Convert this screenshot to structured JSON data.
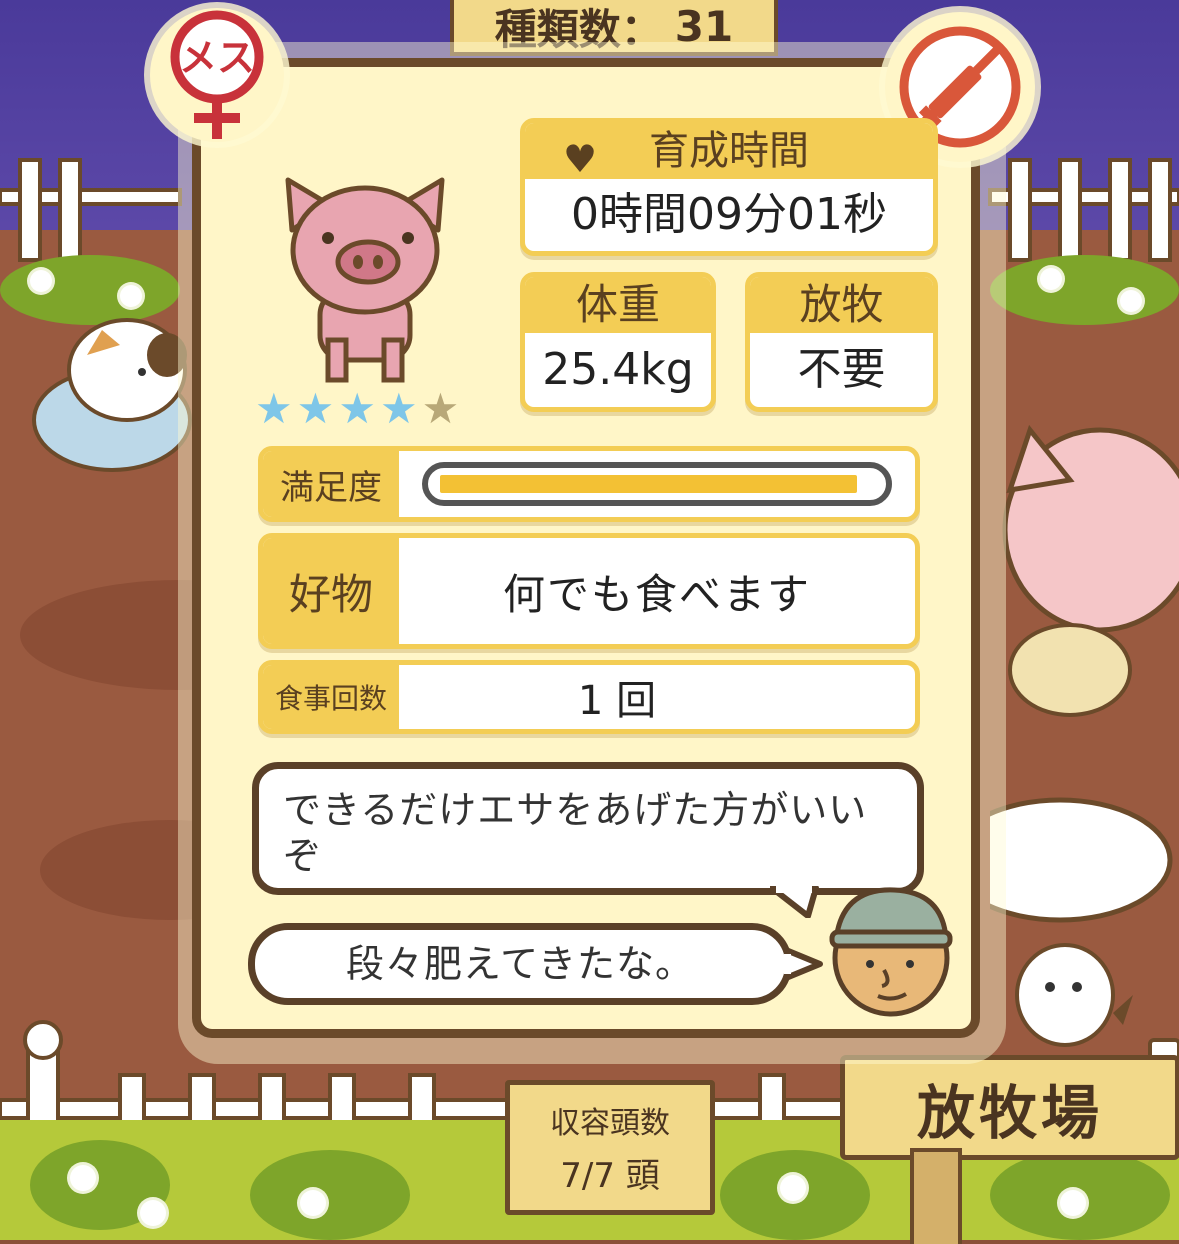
{
  "header": {
    "species_label": "種類数：",
    "species_count": "31"
  },
  "badges": {
    "gender": "メス",
    "gender_icon": "female-symbol",
    "injection_icon": "no-injection"
  },
  "pig": {
    "rating": 4,
    "rating_max": 5
  },
  "stats": {
    "raise_time_label": "育成時間",
    "raise_time_value": "0時間09分01秒",
    "weight_label": "体重",
    "weight_value": "25.4kg",
    "grazing_label": "放牧",
    "grazing_value": "不要"
  },
  "details": {
    "satisfaction_label": "満足度",
    "satisfaction_fraction": 0.96,
    "favorite_label": "好物",
    "favorite_value": "何でも食べます",
    "meals_label": "食事回数",
    "meals_value": "1 回"
  },
  "messages": {
    "advice": "できるだけエサをあげた方がいいぞ",
    "comment": "段々肥えてきたな。"
  },
  "scene": {
    "range_sign": "放牧場",
    "capacity_label": "収容頭数",
    "capacity_value": "7/7 頭"
  },
  "colors": {
    "accent": "#f3cd55",
    "border": "#6b4a2a",
    "star_on": "#7ec6e8",
    "panel": "#fff6c8"
  }
}
